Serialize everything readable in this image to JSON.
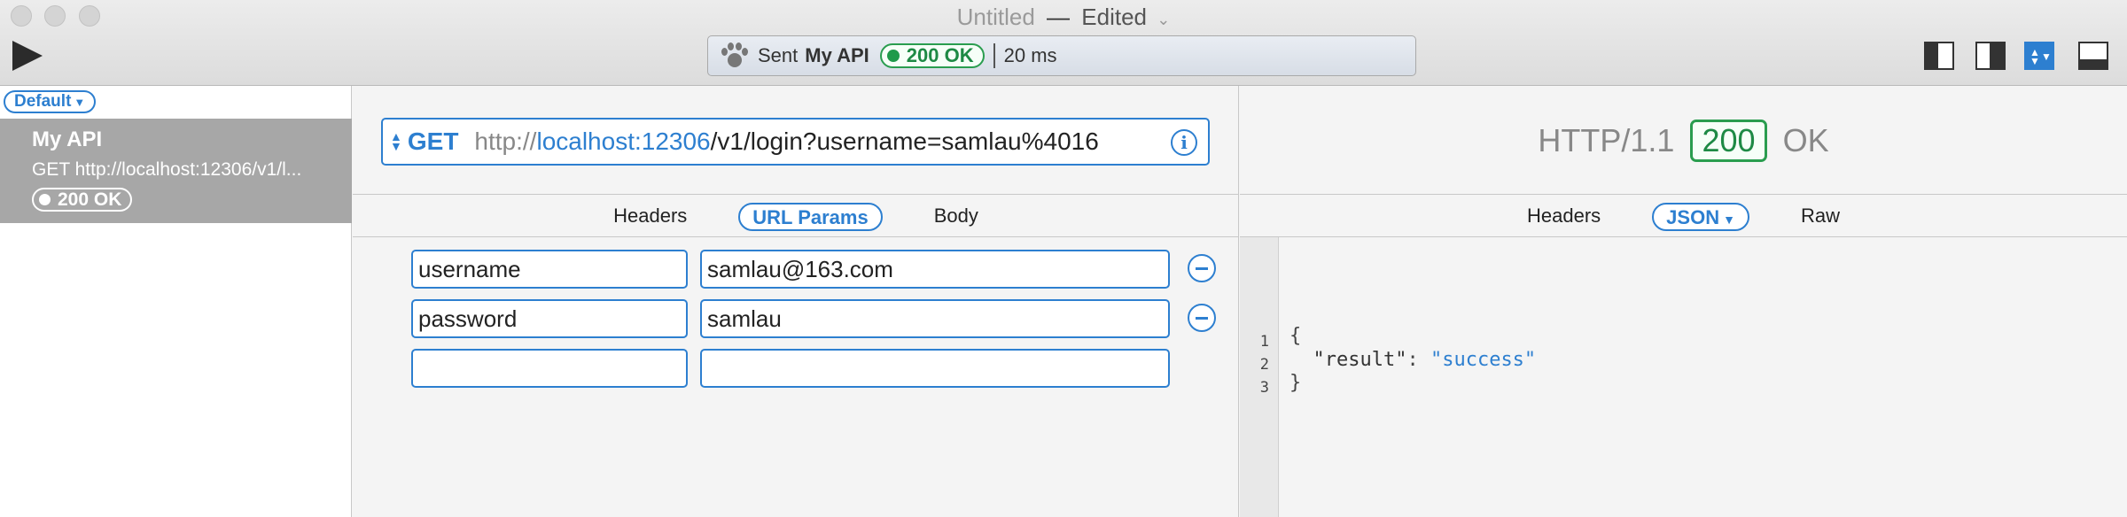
{
  "window": {
    "title": "Untitled",
    "title_sep": "—",
    "edited": "Edited",
    "chevron": "⌄"
  },
  "toolbar": {
    "status_prefix": "Sent",
    "status_request": "My API",
    "status_badge": "200 OK",
    "duration": "20 ms",
    "icons": [
      "play-icon",
      "paw-icon",
      "layout-left-icon",
      "layout-right-icon",
      "layout-split-icon",
      "layout-bottom-icon"
    ]
  },
  "sidebar": {
    "workspace": "Default",
    "requests": [
      {
        "name": "My API",
        "summary": "GET  http://localhost:12306/v1/l...",
        "badge": "200 OK"
      }
    ]
  },
  "request": {
    "method": "GET",
    "url_scheme": "http://",
    "url_host": "localhost:12306",
    "url_path": "/v1/login?username=samlau%4016",
    "info_label": "i",
    "tabs": [
      "Headers",
      "URL Params",
      "Body"
    ],
    "active_tab": "URL Params",
    "params": [
      {
        "key": "username",
        "value": "samlau@163.com"
      },
      {
        "key": "password",
        "value": "samlau"
      },
      {
        "key": "",
        "value": ""
      }
    ]
  },
  "response": {
    "protocol": "HTTP/1.1",
    "code": "200",
    "reason": "OK",
    "tabs": [
      "Headers",
      "JSON",
      "Raw"
    ],
    "active_tab": "JSON",
    "lines": [
      {
        "n": "1",
        "text": "{"
      },
      {
        "n": "2",
        "key": "\"result\"",
        "colon": ": ",
        "value": "\"success\""
      },
      {
        "n": "3",
        "text": "}"
      }
    ]
  },
  "colors": {
    "accent": "#2d7fd0",
    "success": "#1e8a45"
  }
}
